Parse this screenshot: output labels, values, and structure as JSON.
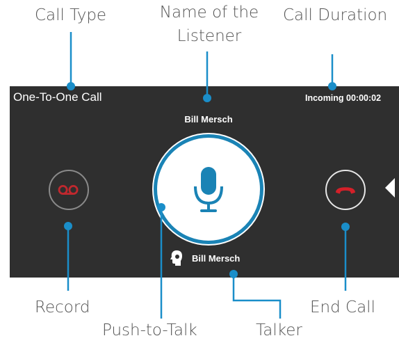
{
  "header": {
    "call_type": "One-To-One Call",
    "call_status": "Incoming 00:00:02"
  },
  "listener_name": "Bill Mersch",
  "talker_name": "Bill Mersch",
  "callouts": {
    "call_type": "Call Type",
    "listener_line1": "Name of the",
    "listener_line2": "Listener",
    "call_duration": "Call Duration",
    "record": "Record",
    "push_to_talk": "Push-to-Talk",
    "talker": "Talker",
    "end_call": "End Call"
  },
  "icons": {
    "record": "voicemail-record-icon",
    "push_to_talk": "microphone-icon",
    "end_call": "phone-hangup-icon",
    "talker": "speaking-head-icon",
    "side_arrow": "collapse-arrow-icon"
  },
  "colors": {
    "panel": "#2f2f2f",
    "callout_line": "#1a8ec9",
    "mic_accent": "#1a83b5",
    "record_red": "#c0282e",
    "end_call_red": "#d42029"
  }
}
